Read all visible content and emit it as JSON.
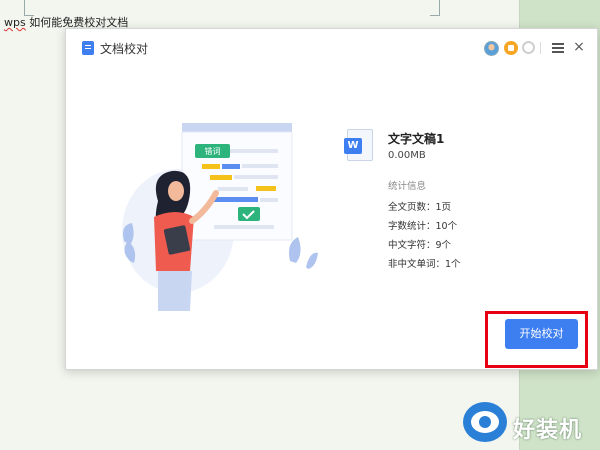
{
  "document": {
    "text_prefix": "wps",
    "text_rest": " 如何能免费校对文档"
  },
  "dialog": {
    "title": "文档校对",
    "close_glyph": "×"
  },
  "illustration": {
    "tag_label": "错词"
  },
  "file": {
    "icon_letter": "W",
    "name": "文字文稿1",
    "size": "0.00MB"
  },
  "stats": {
    "title": "统计信息",
    "rows": [
      "全文页数：1页",
      "字数统计：10个",
      "中文字符：9个",
      "非中文单词：1个"
    ]
  },
  "actions": {
    "start_label": "开始校对"
  },
  "watermark": {
    "text": "好装机"
  },
  "colors": {
    "accent": "#3d7ef0",
    "highlight": "#e60012",
    "tag_green": "#2db37c",
    "yellow": "#f5c21b",
    "person_shirt": "#ef5b4f"
  }
}
